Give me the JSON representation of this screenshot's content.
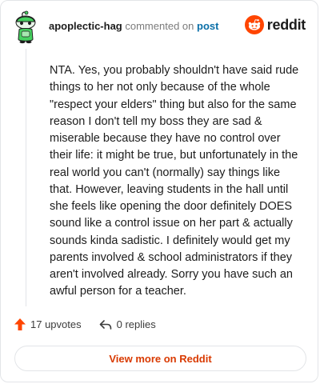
{
  "comment": {
    "username": "apoplectic-hag",
    "action_text": "commented on",
    "target_link": "post",
    "body": "NTA. Yes, you probably shouldn't have said rude things to her not only because of the whole \"respect your elders\" thing but also for the same reason I don't tell my boss they are sad & miserable because they have no control over their life: it might be true, but unfortunately in the real world you can't (normally) say things like that. However, leaving students in the hall until she feels like opening the door definitely DOES sound like a control issue on her part & actually sounds kinda sadistic. I definitely would get my parents involved & school administrators if they aren't involved already. Sorry you have such an awful person for a teacher."
  },
  "brand": {
    "name": "reddit",
    "logo_icon": "reddit-snoo-icon",
    "color": "#ff4500"
  },
  "actions": {
    "upvotes_label": "17 upvotes",
    "upvote_icon": "upvote-arrow-icon",
    "replies_label": "0 replies",
    "reply_icon": "reply-arrow-icon",
    "upvote_color": "#ff4500"
  },
  "footer": {
    "view_more_label": "View more on Reddit",
    "accent": "#d93a00"
  }
}
